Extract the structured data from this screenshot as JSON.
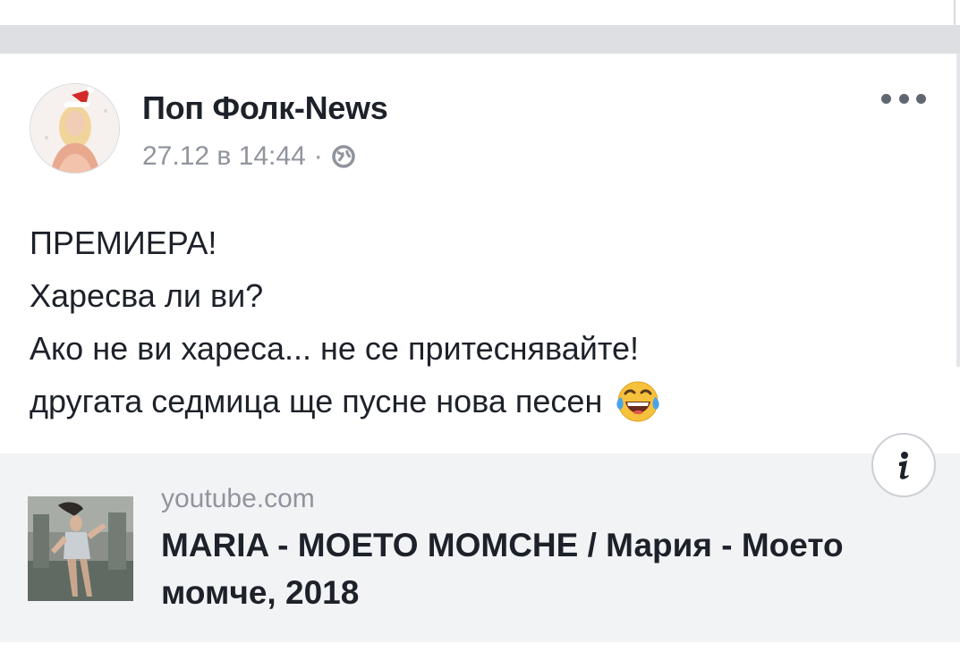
{
  "post": {
    "page_name": "Поп Фолк-News",
    "timestamp": "27.12 в 14:44",
    "separator": "·",
    "privacy_icon": "globe-icon",
    "more_icon": "more-options-icon",
    "text_lines": [
      "ПРЕМИЕРА!",
      "Харесва ли ви?",
      "Ако не ви хареса... не се притеснявайте!",
      "другата седмица ще пусне нова песен"
    ],
    "emoji_icon": "tears-of-joy-emoji"
  },
  "link_preview": {
    "domain": "youtube.com",
    "title": "MARIA - МОЕТО МОМСНЕ / Мария - Моето момче, 2018",
    "info_icon": "info-icon"
  },
  "colors": {
    "background": "#ffffff",
    "separator_band": "#dddfe2",
    "link_box": "#f2f3f5",
    "primary_text": "#1d2129",
    "secondary_text": "#90949c"
  }
}
